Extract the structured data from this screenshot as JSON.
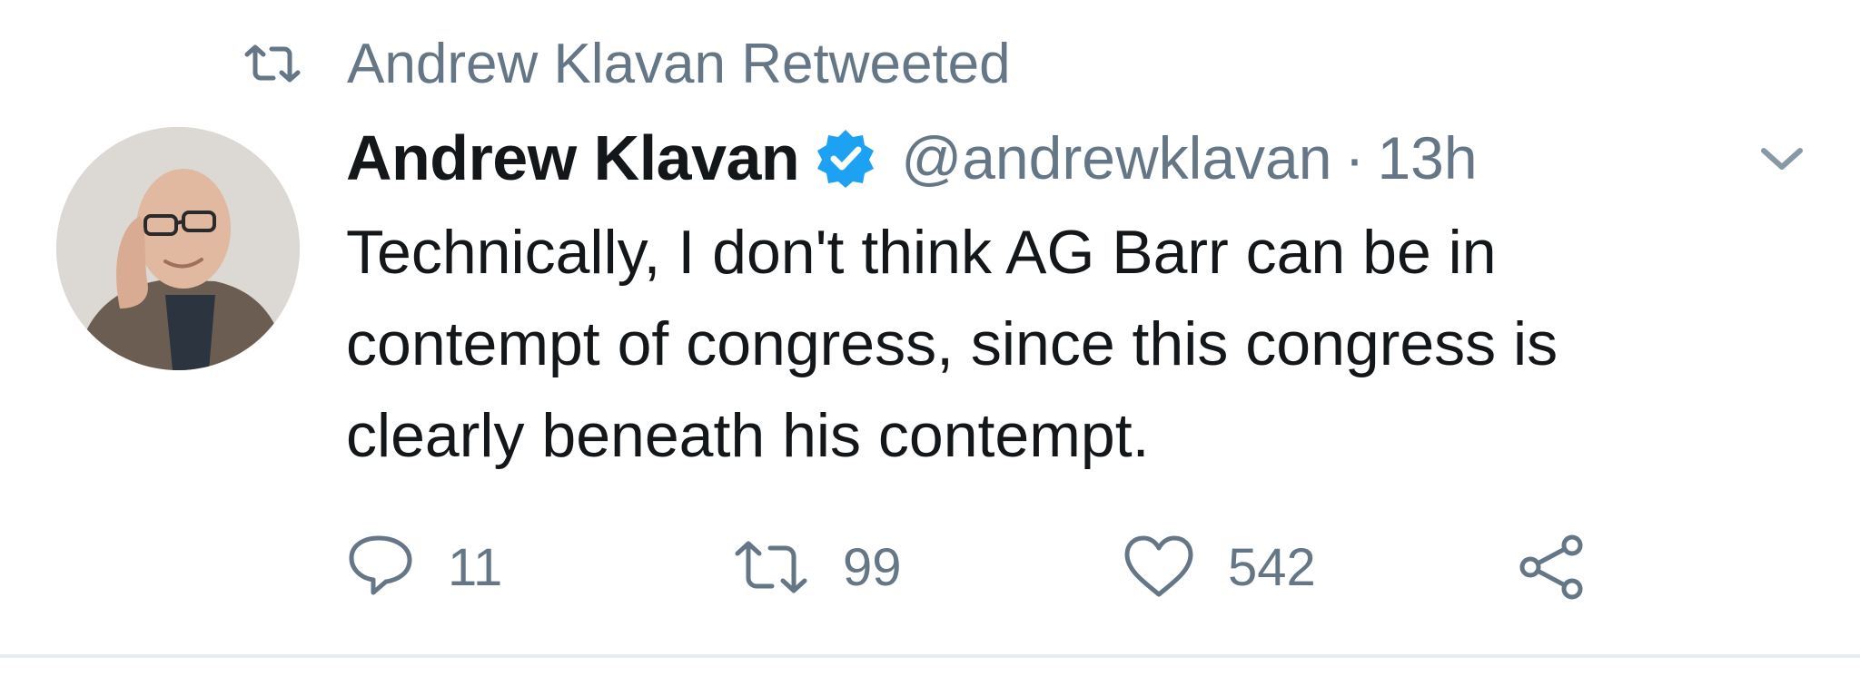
{
  "retweet_context": {
    "text": "Andrew Klavan Retweeted",
    "icon": "retweet-icon"
  },
  "author": {
    "display_name": "Andrew Klavan",
    "handle": "@andrewklavan",
    "verified": true,
    "avatar": "avatar-photo"
  },
  "meta": {
    "separator": "·",
    "time": "13h"
  },
  "tweet": {
    "lines": [
      "Technically, I don't think AG Barr can be in",
      "contempt of congress, since this congress is",
      "clearly beneath his contempt."
    ]
  },
  "actions": {
    "reply": {
      "icon": "reply-icon",
      "count": "11"
    },
    "retweet": {
      "icon": "retweet-icon",
      "count": "99"
    },
    "like": {
      "icon": "heart-icon",
      "count": "542"
    },
    "share": {
      "icon": "share-icon"
    }
  },
  "colors": {
    "text_primary": "#14171a",
    "text_secondary": "#657786",
    "verified_blue": "#1da1f2",
    "divider": "#e6ecf0"
  }
}
